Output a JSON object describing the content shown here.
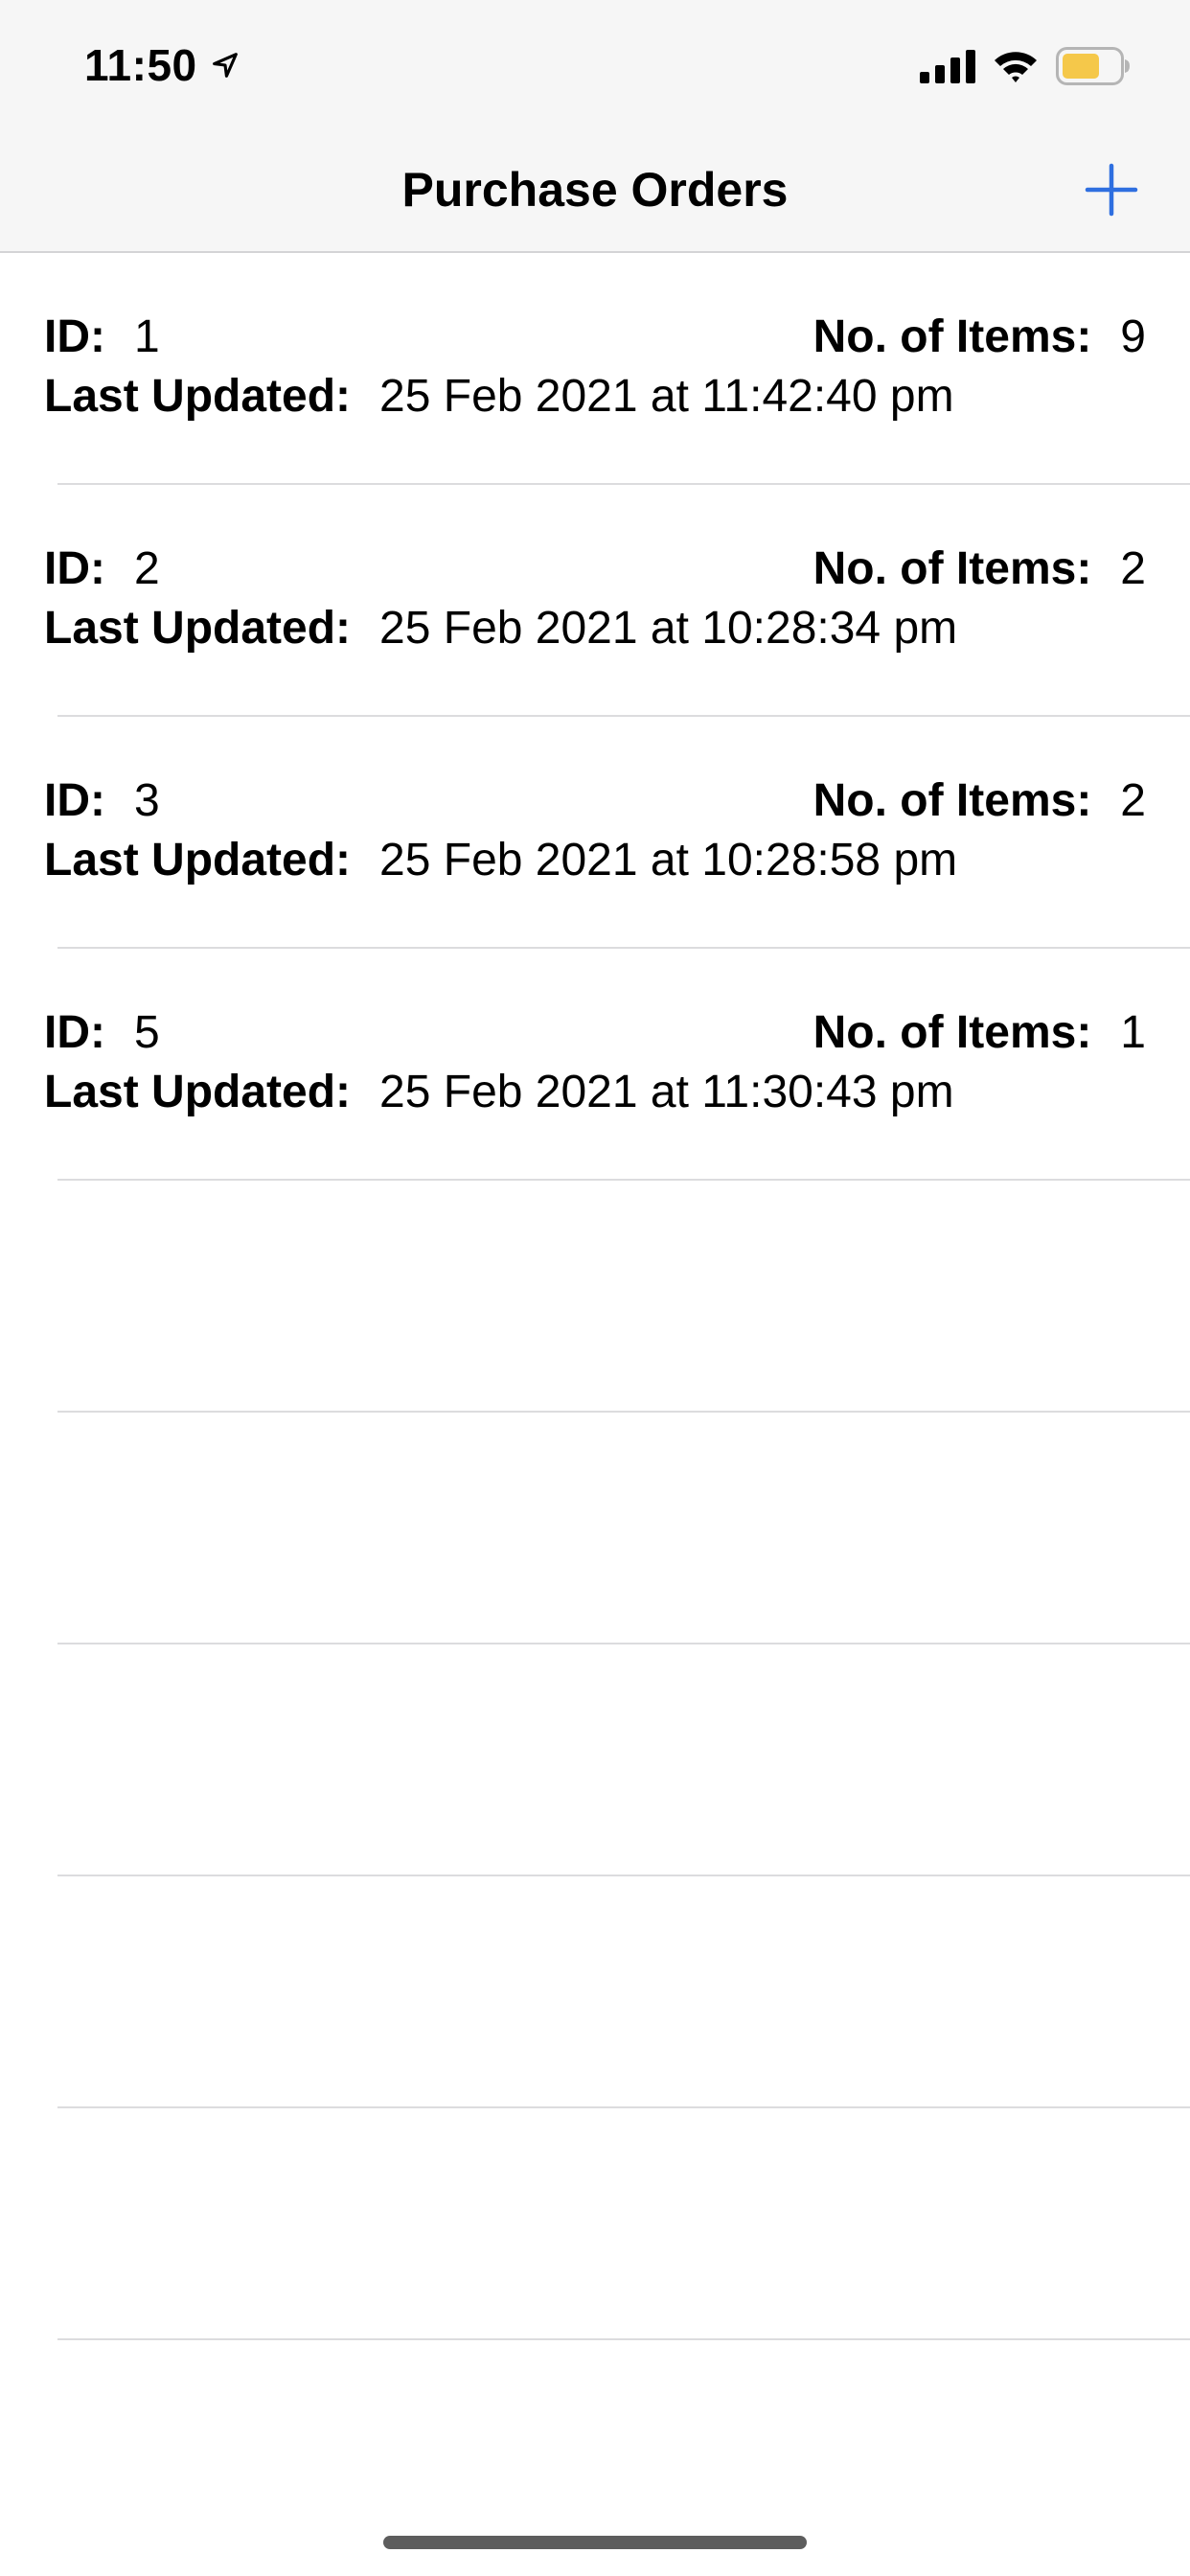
{
  "status_bar": {
    "time": "11:50",
    "icons": [
      "location-arrow-icon",
      "cellular-signal-icon",
      "wifi-icon",
      "battery-icon"
    ],
    "battery_color": "#f5c84a"
  },
  "nav": {
    "title": "Purchase Orders",
    "add_icon": "plus-icon",
    "accent_color": "#2f6fe0"
  },
  "labels": {
    "id": "ID:",
    "items": "No. of Items:",
    "updated": "Last Updated:"
  },
  "orders": [
    {
      "id": "1",
      "items": "9",
      "updated": "25 Feb 2021 at 11:42:40 pm"
    },
    {
      "id": "2",
      "items": "2",
      "updated": "25 Feb 2021 at 10:28:34 pm"
    },
    {
      "id": "3",
      "items": "2",
      "updated": "25 Feb 2021 at 10:28:58 pm"
    },
    {
      "id": "5",
      "items": "1",
      "updated": "25 Feb 2021 at 11:30:43 pm"
    }
  ]
}
